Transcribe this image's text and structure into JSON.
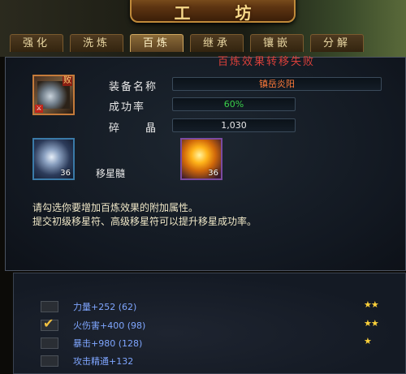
{
  "window": {
    "title": "工 坊"
  },
  "tabs": [
    {
      "label": "强化",
      "active": false
    },
    {
      "label": "洗炼",
      "active": false
    },
    {
      "label": "百炼",
      "active": true
    },
    {
      "label": "继承",
      "active": false
    },
    {
      "label": "镶嵌",
      "active": false
    },
    {
      "label": "分解",
      "active": false
    }
  ],
  "status": {
    "message": "百炼效果转移失败"
  },
  "equipment": {
    "icon": "weapon-blade-icon",
    "corner_badge": "败",
    "name_label": "装备名称",
    "name_value": "镇岳炎阳",
    "success_label": "成功率",
    "success_value": "60%",
    "crystal_label": "碎　　晶",
    "crystal_value": "1,030"
  },
  "materials": {
    "moon_icon": "moon-star-marrow-icon",
    "moon_count": "36",
    "moon_name": "移星髓",
    "gem_icon": "amber-gem-icon",
    "gem_count": "36"
  },
  "notice": {
    "line1": "请勾选你要增加百炼效果的附加属性。",
    "line2": "提交初级移星符、高级移星符可以提升移星成功率。"
  },
  "attributes": [
    {
      "text": "力量+252 (62)",
      "checked": false,
      "stars": "★★"
    },
    {
      "text": "火伤害+400 (98)",
      "checked": true,
      "stars": "★★"
    },
    {
      "text": "暴击+980 (128)",
      "checked": false,
      "stars": "★"
    },
    {
      "text": "攻击精通+132",
      "checked": false,
      "stars": ""
    }
  ],
  "colors": {
    "accent_gold": "#f7d98a",
    "fail_red": "#d8403a",
    "name_orange": "#ff7a3a",
    "success_green": "#3ad04a",
    "attr_blue": "#7fa6ff",
    "star_yellow": "#ffd23a"
  }
}
